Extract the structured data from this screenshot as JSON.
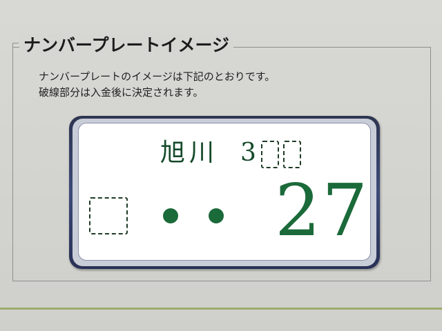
{
  "section": {
    "title": "ナンバープレートイメージ",
    "desc_line1": "ナンバープレートのイメージは下記のとおりです。",
    "desc_line2": "破線部分は入金後に決定されます。"
  },
  "plate": {
    "region": "旭川",
    "class_prefix": "3",
    "number": "27",
    "colors": {
      "text_green": "#1b6a3a",
      "frame_navy": "#2e3550",
      "background": "#ffffff"
    }
  }
}
